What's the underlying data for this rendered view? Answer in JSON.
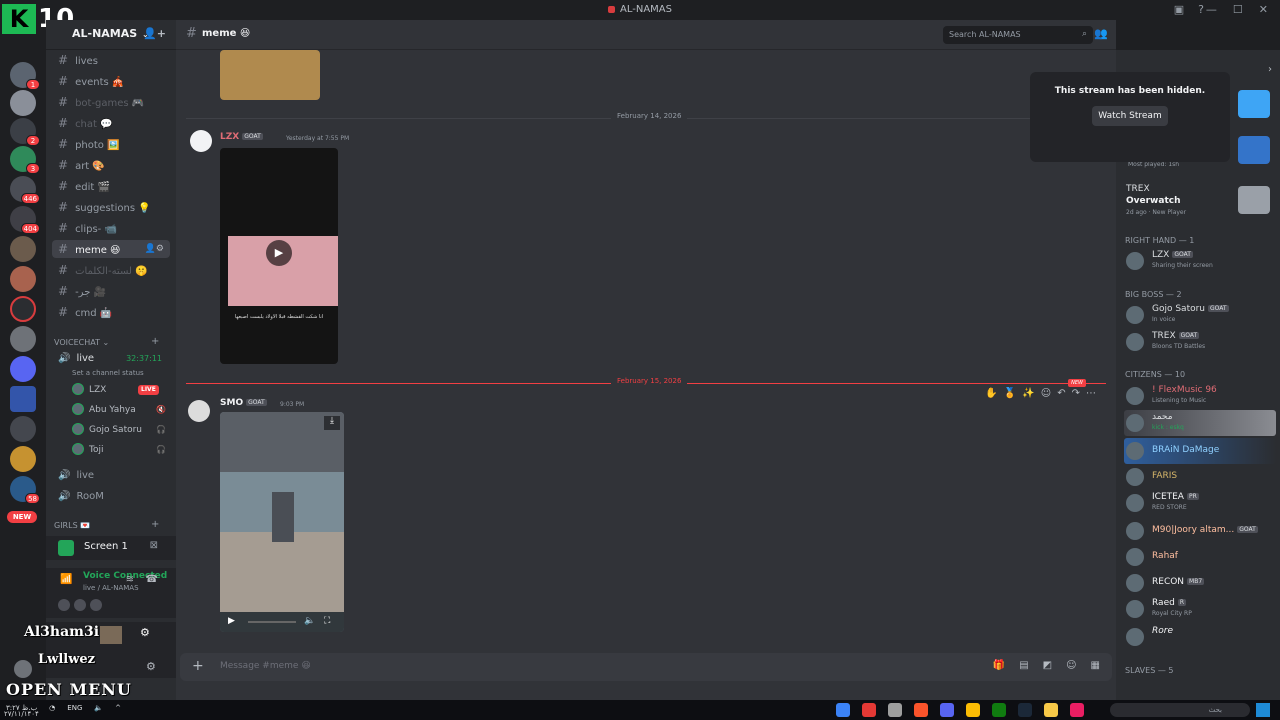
{
  "window": {
    "title": "AL-NAMAS"
  },
  "overlay": {
    "counter": "10",
    "k_letter": "K",
    "bottom_text": "OPEN MENU",
    "clock": "۳:۲۷ ب.ظ",
    "date": "۲۷/۱۱/۱۴۰۴"
  },
  "guilds": {
    "badges": [
      "1",
      "2",
      "3",
      "446",
      "404",
      "58"
    ],
    "new_label": "NEW"
  },
  "server": {
    "name": "AL-NAMAS"
  },
  "channels": [
    {
      "name": "lives"
    },
    {
      "name": "events 🎪"
    },
    {
      "name": "bot-games 🎮"
    },
    {
      "name": "chat 💬"
    },
    {
      "name": "photo 🖼️"
    },
    {
      "name": "art 🎨"
    },
    {
      "name": "edit 🎬"
    },
    {
      "name": "suggestions 💡"
    },
    {
      "name": "clips- 📹"
    },
    {
      "name": "meme 😆"
    },
    {
      "name": "لسته-الكلمات 🤫"
    },
    {
      "name": "-جر 🎥"
    },
    {
      "name": "cmd 🤖"
    }
  ],
  "voice": {
    "category": "VOICECHAT",
    "channel": "live",
    "timer": "32:37:11",
    "status_placeholder": "Set a channel status",
    "users": [
      {
        "name": "LZX",
        "live": "LIVE"
      },
      {
        "name": "Abu Yahya"
      },
      {
        "name": "Gojo Satoru"
      },
      {
        "name": "Toji"
      }
    ],
    "other_channels": [
      "live",
      "RooM"
    ],
    "girls_category": "GIRLS 💌"
  },
  "screen_panel": {
    "label": "Screen 1"
  },
  "voice_panel": {
    "status": "Voice Connected",
    "location": "live / AL-NAMAS"
  },
  "user_panel": {
    "name1": "Al3ham3i",
    "name2": "Lwllwez"
  },
  "chat": {
    "channel_name": "meme 😆",
    "search_placeholder": "Search AL-NAMAS",
    "date1": "February 14, 2026",
    "date2": "February 15, 2026",
    "new_tag": "NEW",
    "msg1": {
      "author": "LZX",
      "tag": "GOAT",
      "time": "Yesterday at 7:55 PM",
      "caption": "انا شكت القشطه قبلا الاولاد يلبست اصبعها"
    },
    "msg2": {
      "author": "SMO",
      "tag": "GOAT",
      "time": "9:03 PM"
    },
    "composer_placeholder": "Message #meme 😆"
  },
  "popover": {
    "title": "This stream has been hidden.",
    "button": "Watch Stream"
  },
  "members": {
    "top": [
      {
        "name": "TREX",
        "game": "Overwatch",
        "status": "2d ago · New Player"
      }
    ],
    "most_played": "Most played: 1sh",
    "right_hand": {
      "title": "RIGHT HAND — 1",
      "items": [
        {
          "name": "LZX",
          "tag": "GOAT",
          "status": "Sharing their screen"
        }
      ]
    },
    "big_boss": {
      "title": "BIG BOSS — 2",
      "items": [
        {
          "name": "Gojo Satoru",
          "tag": "GOAT",
          "status": "In voice"
        },
        {
          "name": "TREX",
          "tag": "GOAT",
          "status": "Bloons TD Battles"
        }
      ]
    },
    "citizens": {
      "title": "CITIZENS — 10",
      "items": [
        {
          "name": "! FlexMusic 96",
          "status": "Listening to Music"
        },
        {
          "name": "محمد",
          "status": "kick : eskq"
        },
        {
          "name": "BRAiN DaMage",
          "status": ""
        },
        {
          "name": "FARIS",
          "status": ""
        },
        {
          "name": "ICETEA",
          "tag": "PR",
          "status": "RED STORE"
        },
        {
          "name": "M90|Joory altam...",
          "tag": "GOAT",
          "status": ""
        },
        {
          "name": "Rahaf",
          "status": ""
        },
        {
          "name": "RECON",
          "tag": "MB7",
          "status": ""
        },
        {
          "name": "Raed",
          "tag": "R",
          "status": "Royal City RP"
        },
        {
          "name": "Rore",
          "status": ""
        }
      ]
    },
    "slaves": {
      "title": "SLAVES — 5"
    }
  },
  "taskbar": {
    "lang": "ENG",
    "search_text": "بحث"
  },
  "colors": {
    "accent_green": "#23a559",
    "red": "#f23f43",
    "blurple": "#5865f2"
  }
}
